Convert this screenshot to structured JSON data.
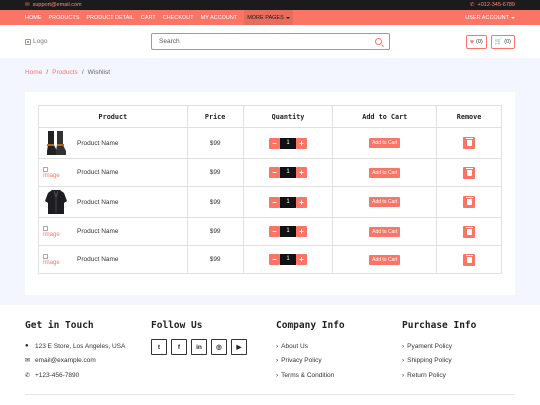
{
  "topbar": {
    "email": "support@email.com",
    "phone": "+012-345-6789"
  },
  "nav": {
    "links": [
      "HOME",
      "PRODUCTS",
      "PRODUCT DETAIL",
      "CART",
      "CHECKOUT",
      "MY ACCOUNT"
    ],
    "more": "MORE PAGES",
    "user": "USER ACCOUNT"
  },
  "header": {
    "logo_alt": "Logo",
    "search_placeholder": "Search",
    "wishlist_count": "(0)",
    "cart_count": "(0)"
  },
  "breadcrumb": {
    "home": "Home",
    "products": "Products",
    "current": "Wishlist"
  },
  "table": {
    "headers": [
      "Product",
      "Price",
      "Quantity",
      "Add to Cart",
      "Remove"
    ],
    "rows": [
      {
        "name": "Product Name",
        "price": "$99",
        "qty": "1",
        "add": "Add to Cart",
        "image": "boots",
        "img_alt": ""
      },
      {
        "name": "Product Name",
        "price": "$99",
        "qty": "1",
        "add": "Add to Cart",
        "image": "broken",
        "img_alt": "Image"
      },
      {
        "name": "Product Name",
        "price": "$99",
        "qty": "1",
        "add": "Add to Cart",
        "image": "jacket",
        "img_alt": ""
      },
      {
        "name": "Product Name",
        "price": "$99",
        "qty": "1",
        "add": "Add to Cart",
        "image": "broken",
        "img_alt": "Image"
      },
      {
        "name": "Product Name",
        "price": "$99",
        "qty": "1",
        "add": "Add to Cart",
        "image": "broken",
        "img_alt": "Image"
      }
    ]
  },
  "footer": {
    "touch": {
      "title": "Get in Touch",
      "address": "123 E Store, Los Angeles, USA",
      "email": "email@example.com",
      "phone": "+123-456-7890"
    },
    "follow": {
      "title": "Follow Us",
      "icons": [
        "twitter-icon",
        "facebook-icon",
        "linkedin-icon",
        "instagram-icon",
        "youtube-icon"
      ]
    },
    "company": {
      "title": "Company Info",
      "links": [
        "About Us",
        "Privacy Policy",
        "Terms & Condition"
      ]
    },
    "purchase": {
      "title": "Purchase Info",
      "links": [
        "Pyament Policy",
        "Shipping Policy",
        "Return Policy"
      ]
    }
  },
  "colors": {
    "accent": "#fa7566",
    "dark": "#1b1b1b"
  }
}
